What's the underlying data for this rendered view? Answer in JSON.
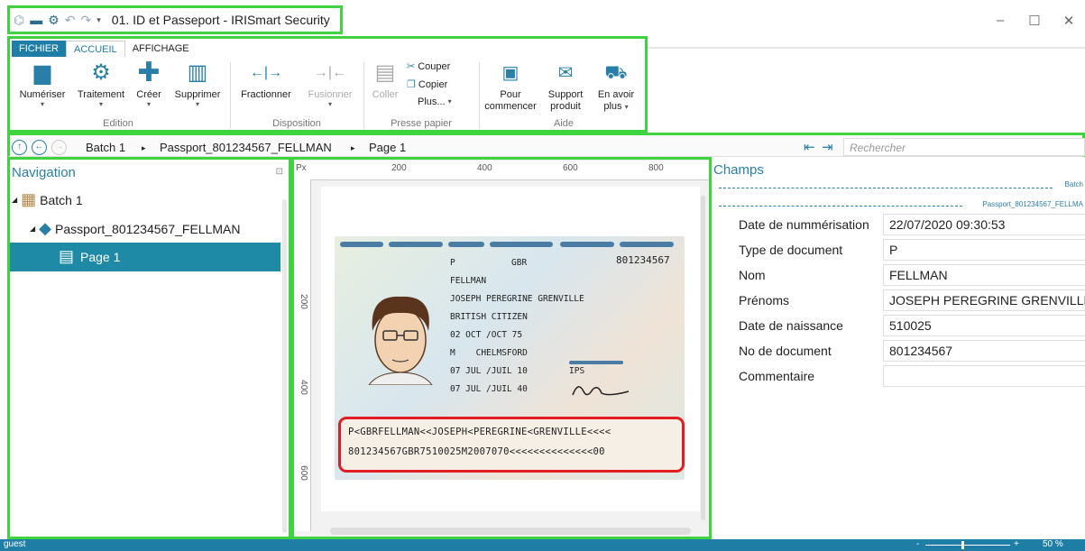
{
  "app": {
    "title": "01. ID et Passeport - IRISmart Security"
  },
  "window_controls": {
    "minimize": "–",
    "maximize": "☐",
    "close": "✕"
  },
  "ribbon": {
    "tabs": [
      "FICHIER",
      "ACCUEIL",
      "AFFICHAGE"
    ],
    "groups": {
      "edition": {
        "label": "Edition",
        "buttons": [
          "Numériser",
          "Traitement",
          "Créer",
          "Supprimer"
        ]
      },
      "disposition": {
        "label": "Disposition",
        "buttons": [
          "Fractionner",
          "Fusionner"
        ]
      },
      "presse_papier": {
        "label": "Presse papier",
        "coller": "Coller",
        "couper": "Couper",
        "copier": "Copier",
        "plus": "Plus..."
      },
      "aide": {
        "label": "Aide",
        "pour_commencer": [
          "Pour",
          "commencer"
        ],
        "support_produit": [
          "Support",
          "produit"
        ],
        "en_avoir_plus": [
          "En avoir",
          "plus"
        ]
      }
    }
  },
  "breadcrumb": {
    "items": [
      "Batch 1",
      "Passport_801234567_FELLMAN",
      "Page 1"
    ],
    "search_placeholder": "Rechercher"
  },
  "navigation": {
    "title": "Navigation",
    "batch": "Batch 1",
    "document": "Passport_801234567_FELLMAN",
    "page": "Page 1"
  },
  "viewer": {
    "ruler_unit": "Px",
    "ruler_top": [
      "200",
      "400",
      "600",
      "800"
    ],
    "ruler_left": [
      "200",
      "400",
      "600"
    ],
    "passport": {
      "type": "P",
      "country": "GBR",
      "number": "801234567",
      "surname": "FELLMAN",
      "given_names": "JOSEPH PEREGRINE GRENVILLE",
      "nationality": "BRITISH CITIZEN",
      "dob": "02 OCT /OCT 75",
      "sex_place": "M    CHELMSFORD",
      "issue": "07 JUL /JUIL 10",
      "authority": "IPS",
      "expiry": "07 JUL /JUIL 40",
      "mrz1": "P<GBRFELLMAN<<JOSEPH<PEREGRINE<GRENVILLE<<<<",
      "mrz2": "801234567GBR7510025M2007070<<<<<<<<<<<<<<00"
    }
  },
  "fields": {
    "title": "Champs",
    "batch_label": "Batch",
    "doc_label": "Passport_801234567_FELLMA",
    "rows": [
      {
        "label": "Date de nummérisation",
        "value": "22/07/2020 09:30:53"
      },
      {
        "label": "Type de document",
        "value": "P"
      },
      {
        "label": "Nom",
        "value": "FELLMAN"
      },
      {
        "label": "Prénoms",
        "value": "JOSEPH PEREGRINE GRENVILLE"
      },
      {
        "label": "Date de naissance",
        "value": "510025"
      },
      {
        "label": "No de document",
        "value": "801234567"
      },
      {
        "label": "Commentaire",
        "value": ""
      }
    ]
  },
  "status": {
    "user": "guest",
    "zoom": "50 %"
  }
}
